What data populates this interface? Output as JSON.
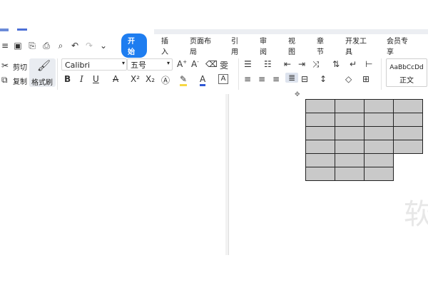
{
  "quick_access": {
    "icons": [
      "menu-icon",
      "save-icon",
      "export-icon",
      "print-icon",
      "preview-icon",
      "undo-icon",
      "redo-icon",
      "more-icon"
    ]
  },
  "tabs": [
    {
      "label": "开始",
      "active": true
    },
    {
      "label": "插入"
    },
    {
      "label": "页面布局"
    },
    {
      "label": "引用"
    },
    {
      "label": "审阅"
    },
    {
      "label": "视图"
    },
    {
      "label": "章节"
    },
    {
      "label": "开发工具"
    },
    {
      "label": "会员专享"
    }
  ],
  "clipboard": {
    "cut": "剪切",
    "copy": "复制",
    "format_painter": "格式刷"
  },
  "font": {
    "name": "Calibri",
    "size": "五号"
  },
  "styles": {
    "preview": "AaBbCcDd",
    "name": "正文"
  },
  "watermark": "软",
  "colors": {
    "accent": "#1e7df0",
    "table_fill": "#c9c9c9",
    "underline_red": "#e23b3b",
    "highlight_yellow": "#f6d743",
    "font_color_blue": "#2f57d4"
  }
}
